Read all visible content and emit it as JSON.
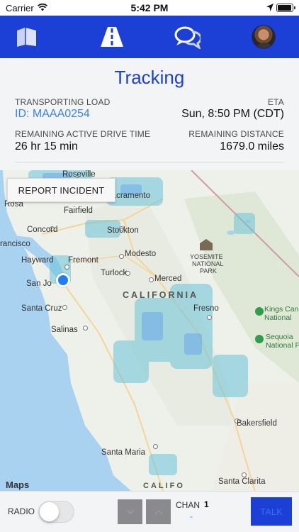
{
  "status_bar": {
    "carrier": "Carrier",
    "time": "5:42 PM",
    "icons": [
      "wifi-icon",
      "location-arrow-icon",
      "battery-icon"
    ]
  },
  "navbar": {
    "background": "#1c3fd6",
    "items": [
      {
        "icon": "map-book-icon"
      },
      {
        "icon": "road-icon",
        "active": true
      },
      {
        "icon": "chat-bubbles-icon"
      },
      {
        "icon": "profile-avatar"
      }
    ]
  },
  "tracking": {
    "title": "Tracking",
    "transporting_load_label": "TRANSPORTING LOAD",
    "load_id": "ID: MAAA0254",
    "eta_label": "ETA",
    "eta_value": "Sun, 8:50 PM (CDT)",
    "drive_time_label": "REMAINING ACTIVE DRIVE TIME",
    "drive_time_value": "26 hr 15 min",
    "distance_label": "REMAINING DISTANCE",
    "distance_value": "1679.0 miles"
  },
  "map": {
    "report_incident_label": "REPORT INCIDENT",
    "attribution": " Maps",
    "region_label": "CALIFORNIA",
    "park_label_1": "YOSEMITE",
    "park_label_2": "NATIONAL",
    "park_label_3": "PARK",
    "kings_canyon": "Kings Can",
    "kings_canyon_2": "National",
    "sequoia": "Sequoia",
    "sequoia_2": "National P",
    "cities": {
      "roseville": "Roseville",
      "sacramento": "Sacramento",
      "rosa": "Rosa",
      "fairfield": "Fairfield",
      "concord": "Concord",
      "stockton": "Stockton",
      "francisco": "rancisco",
      "modesto": "Modesto",
      "hayward": "Hayward",
      "fremont": "Fremont",
      "turlock": "Turlock",
      "merced": "Merced",
      "san_jose": "San Jo",
      "santa_cruz": "Santa Cruz",
      "fresno": "Fresno",
      "salinas": "Salinas",
      "bakersfield": "Bakersfield",
      "santa_maria": "Santa Maria",
      "santa_clarita": "Santa Clarita",
      "california_partial": "CALIFO"
    }
  },
  "bottom_bar": {
    "radio_label": "RADIO",
    "radio_on": false,
    "chan_label": "CHAN",
    "chan_value": "1",
    "chan_sub": "-",
    "talk_label": "TALK"
  }
}
